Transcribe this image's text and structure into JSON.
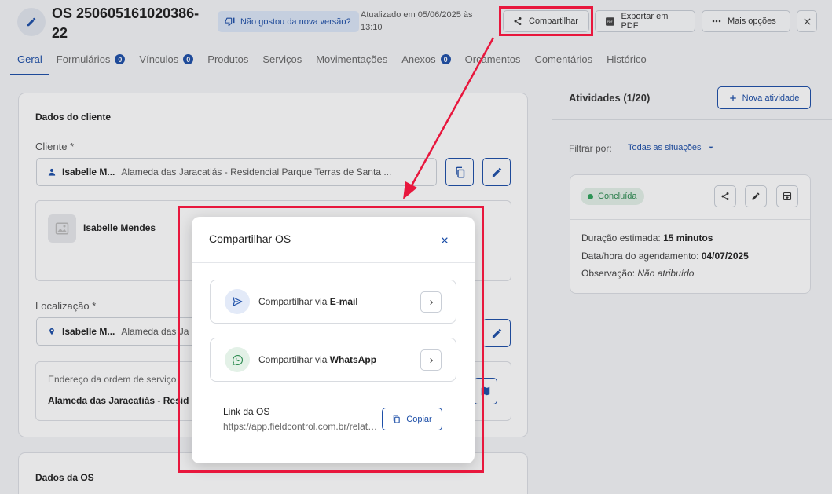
{
  "header": {
    "os_title": "OS 250605161020386-22",
    "feedback": "Não gostou da nova versão?",
    "updated": "Atualizado em 05/06/2025 às 13:10",
    "share_label": "Compartilhar",
    "pdf_label": "Exportar em PDF",
    "more_label": "Mais opções"
  },
  "tabs": [
    {
      "label": "Geral"
    },
    {
      "label": "Formulários",
      "badge": "0"
    },
    {
      "label": "Vínculos",
      "badge": "0"
    },
    {
      "label": "Produtos"
    },
    {
      "label": "Serviços"
    },
    {
      "label": "Movimentações"
    },
    {
      "label": "Anexos",
      "badge": "0"
    },
    {
      "label": "Orçamentos"
    },
    {
      "label": "Comentários"
    },
    {
      "label": "Histórico"
    }
  ],
  "client": {
    "section_title": "Dados do cliente",
    "client_label": "Cliente *",
    "client_name": "Isabelle M...",
    "client_address": "Alameda das Jaracatiás - Residencial Parque Terras de Santa ...",
    "card_name": "Isabelle Mendes",
    "location_label": "Localização *",
    "location_name": "Isabelle M...",
    "location_address": "Alameda das Ja",
    "address_label": "Endereço da ordem de serviço",
    "address_value": "Alameda das Jaracatiás - Resid"
  },
  "os_section": {
    "title": "Dados da OS"
  },
  "activities": {
    "title": "Atividades (1/20)",
    "new_label": "Nova atividade",
    "filter_label": "Filtrar por:",
    "filter_value": "Todas as situações",
    "card": {
      "status": "Concluída",
      "duration_label": "Duração estimada:",
      "duration_value": "15 minutos",
      "schedule_label": "Data/hora do agendamento:",
      "schedule_value": "04/07/2025",
      "note_label": "Observação:",
      "note_value": "Não atribuído"
    }
  },
  "modal": {
    "title": "Compartilhar OS",
    "email_prefix": "Compartilhar via ",
    "email_channel": "E-mail",
    "whatsapp_prefix": "Compartilhar via ",
    "whatsapp_channel": "WhatsApp",
    "link_label": "Link da OS",
    "link_url": "https://app.fieldcontrol.com.br/relatorio",
    "copy_label": "Copiar"
  },
  "colors": {
    "primary": "#1d4fa8",
    "annotation": "#e8173d",
    "success": "#2ea35a"
  }
}
